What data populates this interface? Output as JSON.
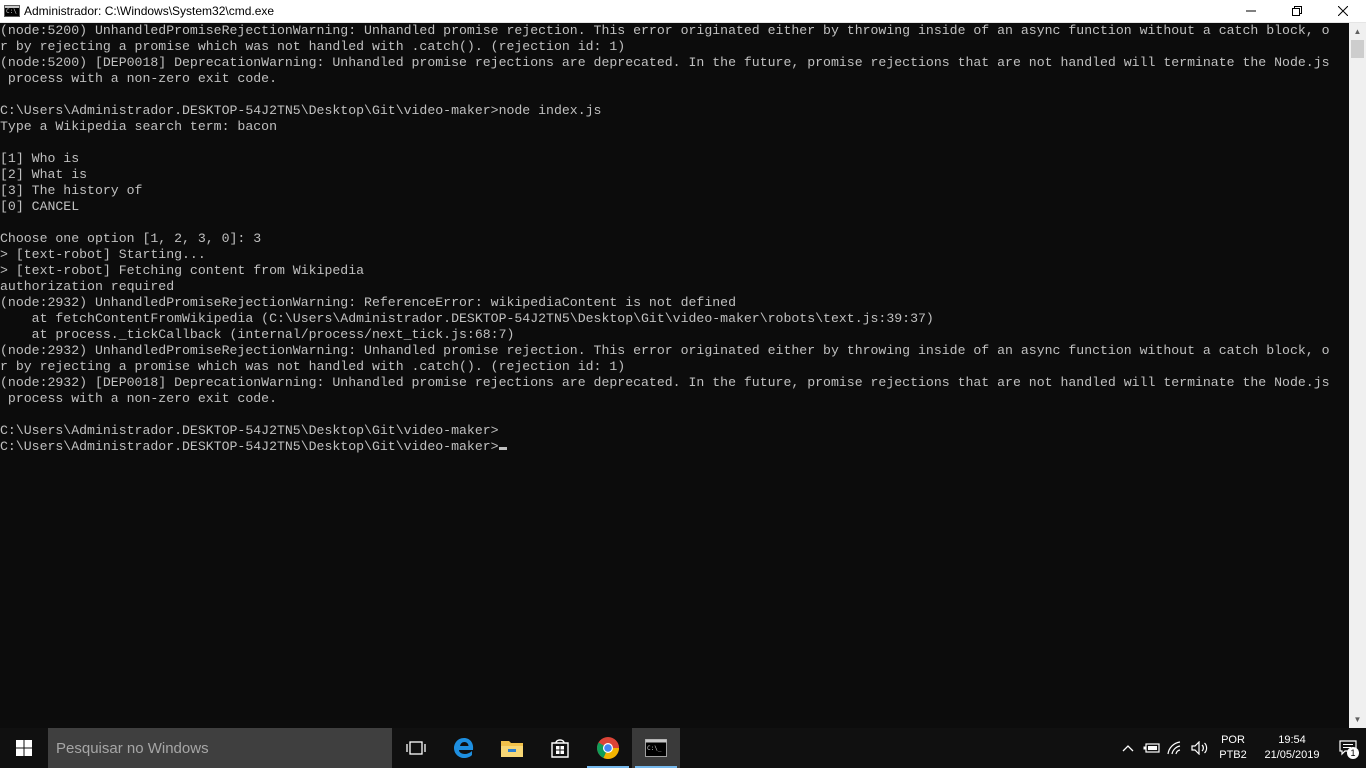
{
  "window": {
    "title": "Administrador: C:\\Windows\\System32\\cmd.exe",
    "icon_name": "cmd-icon",
    "minimize_icon": "minimize-icon",
    "restore_icon": "restore-icon",
    "close_icon": "close-icon"
  },
  "console": {
    "text_color": "#c0c0c0",
    "background": "#0c0c0c",
    "lines": [
      "(node:5200) UnhandledPromiseRejectionWarning: Unhandled promise rejection. This error originated either by throwing inside of an async function without a catch block, o",
      "r by rejecting a promise which was not handled with .catch(). (rejection id: 1)",
      "(node:5200) [DEP0018] DeprecationWarning: Unhandled promise rejections are deprecated. In the future, promise rejections that are not handled will terminate the Node.js",
      " process with a non-zero exit code.",
      "",
      "C:\\Users\\Administrador.DESKTOP-54J2TN5\\Desktop\\Git\\video-maker>node index.js",
      "Type a Wikipedia search term: bacon",
      "",
      "[1] Who is",
      "[2] What is",
      "[3] The history of",
      "[0] CANCEL",
      "",
      "Choose one option [1, 2, 3, 0]: 3",
      "> [text-robot] Starting...",
      "> [text-robot] Fetching content from Wikipedia",
      "authorization required",
      "(node:2932) UnhandledPromiseRejectionWarning: ReferenceError: wikipediaContent is not defined",
      "    at fetchContentFromWikipedia (C:\\Users\\Administrador.DESKTOP-54J2TN5\\Desktop\\Git\\video-maker\\robots\\text.js:39:37)",
      "    at process._tickCallback (internal/process/next_tick.js:68:7)",
      "(node:2932) UnhandledPromiseRejectionWarning: Unhandled promise rejection. This error originated either by throwing inside of an async function without a catch block, o",
      "r by rejecting a promise which was not handled with .catch(). (rejection id: 1)",
      "(node:2932) [DEP0018] DeprecationWarning: Unhandled promise rejections are deprecated. In the future, promise rejections that are not handled will terminate the Node.js",
      " process with a non-zero exit code.",
      "",
      "C:\\Users\\Administrador.DESKTOP-54J2TN5\\Desktop\\Git\\video-maker>",
      "C:\\Users\\Administrador.DESKTOP-54J2TN5\\Desktop\\Git\\video-maker>"
    ]
  },
  "scrollbar": {
    "up_icon": "scroll-up-arrow-icon",
    "down_icon": "scroll-down-arrow-icon"
  },
  "taskbar": {
    "start_icon": "windows-logo-icon",
    "search_placeholder": "Pesquisar no Windows",
    "pinned": [
      {
        "name": "task-view-icon"
      },
      {
        "name": "edge-icon"
      },
      {
        "name": "file-explorer-icon"
      },
      {
        "name": "store-icon"
      },
      {
        "name": "chrome-icon"
      },
      {
        "name": "cmd-taskbar-icon"
      }
    ],
    "tray": {
      "icons": [
        "chevron-up-icon",
        "battery-icon",
        "wifi-icon",
        "volume-icon"
      ],
      "language": "POR",
      "keyboard": "PTB2",
      "time": "19:54",
      "date": "21/05/2019",
      "notification_count": "1"
    },
    "accent_color": "#76b9ed"
  }
}
